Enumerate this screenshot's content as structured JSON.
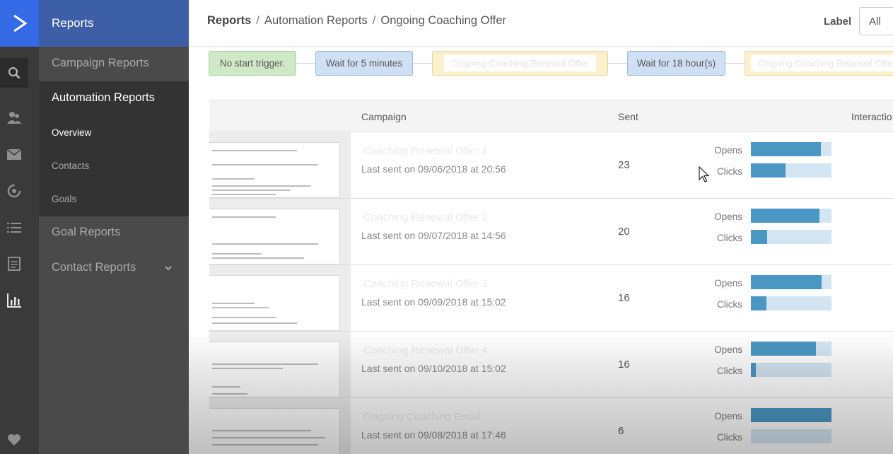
{
  "sidebar": {
    "header": "Reports",
    "items": [
      {
        "label": "Campaign Reports"
      },
      {
        "label": "Automation Reports"
      },
      {
        "label": "Goal Reports"
      },
      {
        "label": "Contact Reports"
      }
    ],
    "subitems": [
      {
        "label": "Overview"
      },
      {
        "label": "Contacts"
      },
      {
        "label": "Goals"
      }
    ]
  },
  "rail_icons": [
    "logo-chevron-icon",
    "search-icon",
    "contacts-icon",
    "mail-icon",
    "automation-icon",
    "list-icon",
    "forms-icon",
    "reports-icon",
    "heart-icon"
  ],
  "breadcrumb": {
    "root": "Reports",
    "sep": "/",
    "level2": "Automation Reports",
    "current": "Ongoing Coaching Offer"
  },
  "label_filter": {
    "label": "Label",
    "value": "All"
  },
  "workflow": {
    "steps": [
      {
        "text": "No start trigger.",
        "kind": "trigger"
      },
      {
        "text": "Wait for 5 minutes",
        "kind": "wait"
      },
      {
        "text": "Ongoing Coaching Renewal Offer",
        "kind": "send"
      },
      {
        "text": "Wait for 18 hour(s)",
        "kind": "wait"
      },
      {
        "text": "Ongoing Coaching Renewal Offer",
        "kind": "send"
      }
    ]
  },
  "table": {
    "columns": {
      "campaign": "Campaign",
      "sent": "Sent",
      "interactions": "Interactio"
    },
    "metric_labels": {
      "opens": "Opens",
      "clicks": "Clicks"
    },
    "rows": [
      {
        "name": "Coaching Renewal Offer 1",
        "last_sent": "Last sent on 09/06/2018 at 20:56",
        "sent": "23",
        "opens": 0.87,
        "clicks": 0.43
      },
      {
        "name": "Coaching Renewal Offer 2",
        "last_sent": "Last sent on 09/07/2018 at 14:56",
        "sent": "20",
        "opens": 0.85,
        "clicks": 0.2
      },
      {
        "name": "Coaching Renewal Offer 3",
        "last_sent": "Last sent on 09/09/2018 at 15:02",
        "sent": "16",
        "opens": 0.88,
        "clicks": 0.19
      },
      {
        "name": "Coaching Renewal Offer 4",
        "last_sent": "Last sent on 09/10/2018 at 15:02",
        "sent": "16",
        "opens": 0.81,
        "clicks": 0.06
      },
      {
        "name": "Ongoing Coaching Email",
        "last_sent": "Last sent on 09/08/2018 at 17:46",
        "sent": "6",
        "opens": 1.0,
        "clicks": 0.0
      }
    ]
  },
  "colors": {
    "accent": "#356ae6",
    "sidebar_header": "#3d5fa8",
    "bar_fill": "#4b97c4",
    "bar_track": "#d3e5f3"
  }
}
